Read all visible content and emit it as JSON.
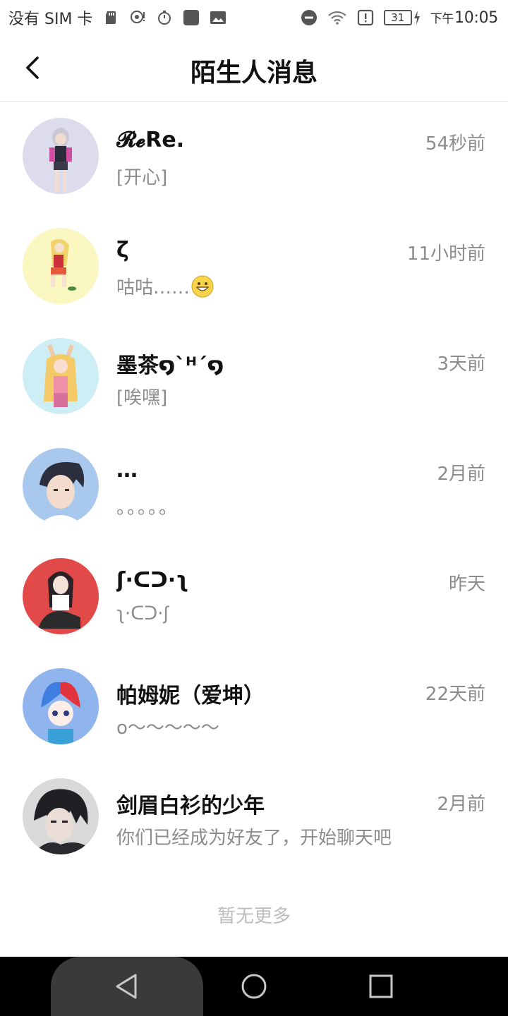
{
  "status_bar": {
    "carrier": "没有 SIM 卡",
    "battery": "31",
    "time_prefix": "下午",
    "time": "10:05"
  },
  "header": {
    "title": "陌生人消息"
  },
  "conversations": [
    {
      "name": "𝓡𝓮Re.",
      "time": "54秒前",
      "preview": "[开心]",
      "bg": "#dcdcec"
    },
    {
      "name": "ζ",
      "time": "11小时前",
      "preview": "咕咕……",
      "bg": "#fbf7c0"
    },
    {
      "name": "墨茶໑`ᴴ´໑",
      "time": "3天前",
      "preview": "[唉嘿]",
      "bg": "#cdeef4"
    },
    {
      "name": "…",
      "time": "2月前",
      "preview": "。。。。。",
      "bg": "#a9c8ee"
    },
    {
      "name": "ʃ·ᑕᑐ·ʅ",
      "time": "昨天",
      "preview": "ʅ·ᑕᑐ·ʃ",
      "bg": "#e24a4a"
    },
    {
      "name": "帕姆妮（爱坤）",
      "time": "22天前",
      "preview": "o〜〜〜〜〜",
      "bg": "#8fb4ee"
    },
    {
      "name": "剑眉白衫的少年",
      "time": "2月前",
      "preview": "你们已经成为好友了，开始聊天吧",
      "bg": "#d9d9d9"
    }
  ],
  "footer": {
    "note": "暂无更多"
  },
  "icons": {
    "back": "chevron-left-icon",
    "nav_back": "triangle-back-icon",
    "nav_home": "circle-home-icon",
    "nav_recents": "square-recents-icon"
  }
}
